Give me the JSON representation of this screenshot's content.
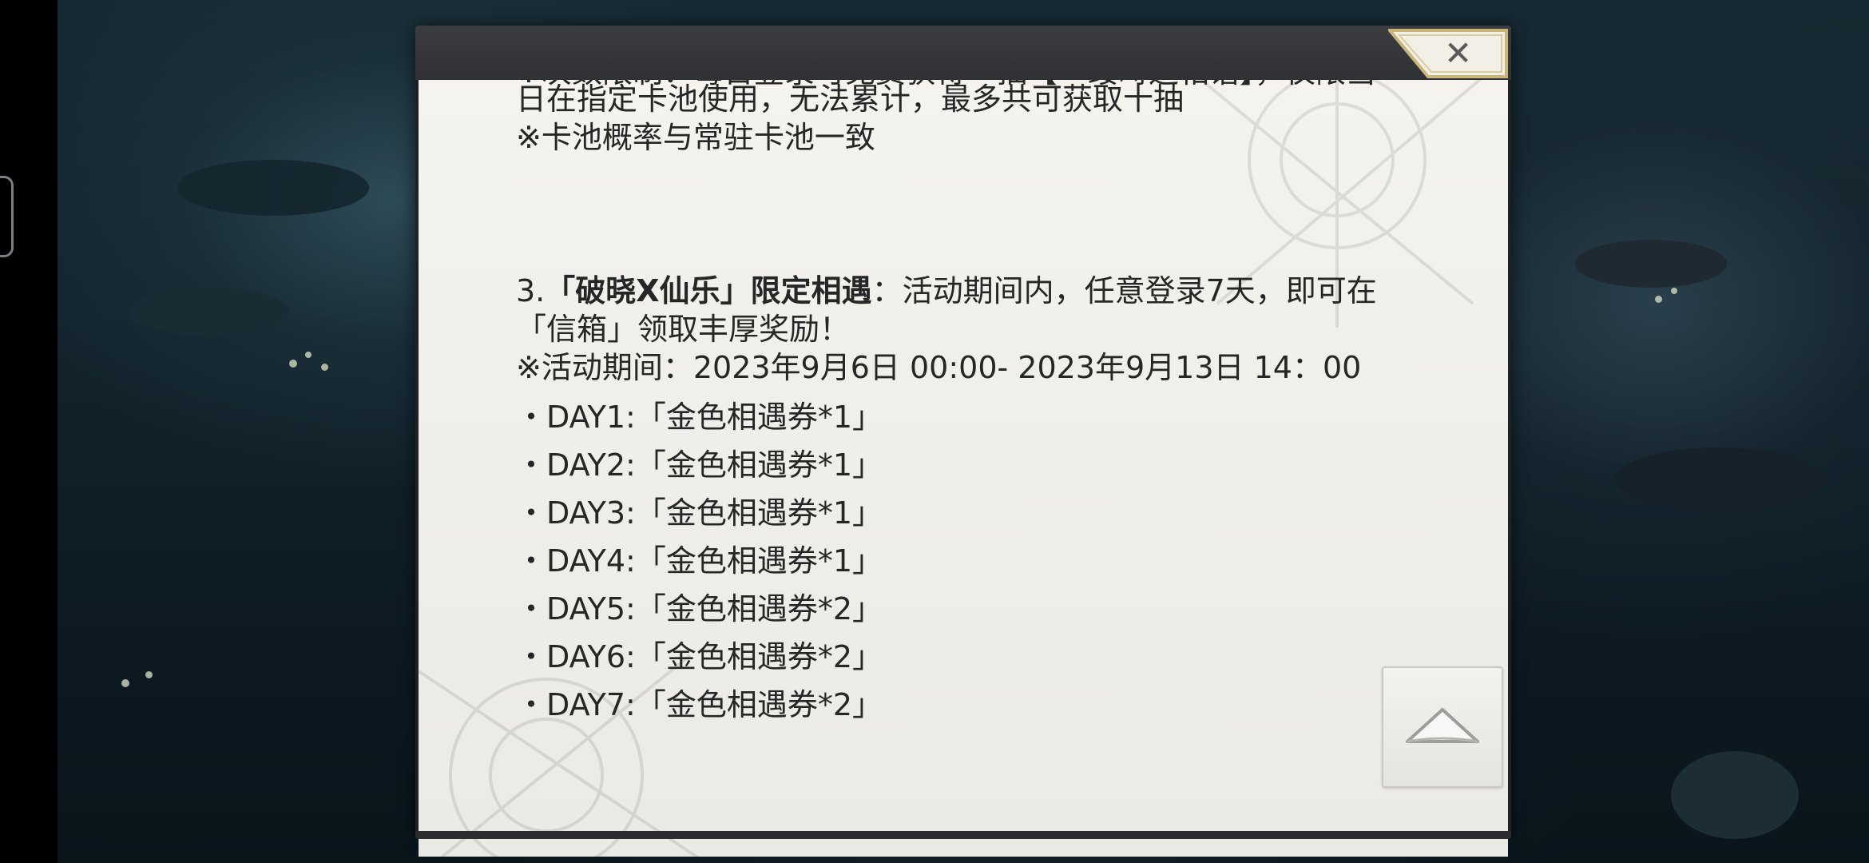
{
  "dialog": {
    "close_label": "✕",
    "cut_text": "※次数限制：每日登录可免费获得一抽【一缕時运相谐】，仅限当",
    "intro_lines": [
      "日在指定卡池使用，无法累计，最多共可获取十抽",
      "※卡池概率与常驻卡池一致"
    ],
    "section3": {
      "number": "3.",
      "title": "「破晓X仙乐」限定相遇",
      "description_part1": "：活动期间内，任意登录7天，即可在",
      "description_part2": "「信箱」领取丰厚奖励！",
      "period": "※活动期间：2023年9月6日 00:00- 2023年9月13日 14：00",
      "days": [
        "・DAY1:「金色相遇券*1」",
        "・DAY2:「金色相遇券*1」",
        "・DAY3:「金色相遇券*1」",
        "・DAY4:「金色相遇券*1」",
        "・DAY5:「金色相遇券*2」",
        "・DAY6:「金色相遇券*2」",
        "・DAY7:「金色相遇券*2」"
      ]
    },
    "scroll_top_icon": "chevron-up-icon"
  },
  "colors": {
    "panel_bg": "#efeee9",
    "header_bg": "#333538",
    "text": "#262626",
    "close_tab_border": "#c9b77a"
  }
}
